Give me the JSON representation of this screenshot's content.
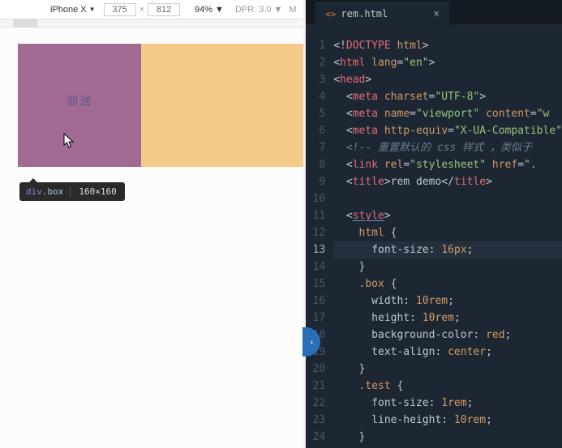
{
  "toolbar": {
    "device": "iPhone X",
    "width": "375",
    "height": "812",
    "dim_sep": "×",
    "zoom": "94%",
    "dpr_label": "DPR:",
    "dpr_value": "3.0",
    "m_label": "M"
  },
  "preview": {
    "box_text": "测试"
  },
  "inspect": {
    "element": "div",
    "class": ".box",
    "dimensions": "160×160"
  },
  "tab": {
    "filename": "rem.html",
    "icon_glyph": "<>"
  },
  "code": {
    "lines": [
      {
        "n": "1",
        "html": "<span class='p'>&lt;!</span><span class='t'>DOCTYPE</span> <span class='a'>html</span><span class='p'>&gt;</span>"
      },
      {
        "n": "2",
        "html": "<span class='p'>&lt;</span><span class='t'>html</span> <span class='a'>lang</span><span class='p'>=</span><span class='s'>\"en\"</span><span class='p'>&gt;</span>"
      },
      {
        "n": "3",
        "html": "<span class='p'>&lt;</span><span class='t'>head</span><span class='p'>&gt;</span>"
      },
      {
        "n": "4",
        "html": "  <span class='p'>&lt;</span><span class='t'>meta</span> <span class='a'>charset</span><span class='p'>=</span><span class='s'>\"UTF-8\"</span><span class='p'>&gt;</span>"
      },
      {
        "n": "5",
        "html": "  <span class='p'>&lt;</span><span class='t'>meta</span> <span class='a'>name</span><span class='p'>=</span><span class='s'>\"viewport\"</span> <span class='a'>content</span><span class='p'>=</span><span class='s'>\"w</span>"
      },
      {
        "n": "6",
        "html": "  <span class='p'>&lt;</span><span class='t'>meta</span> <span class='a'>http-equiv</span><span class='p'>=</span><span class='s'>\"X-UA-Compatible\"</span>"
      },
      {
        "n": "7",
        "html": "  <span class='cm'>&lt;!-- 重置默认的 css 样式 ，类似于</span>"
      },
      {
        "n": "8",
        "html": "  <span class='p'>&lt;</span><span class='t'>link</span> <span class='a'>rel</span><span class='p'>=</span><span class='s'>\"stylesheet\"</span> <span class='a'>href</span><span class='p'>=</span><span class='s'>\".</span>"
      },
      {
        "n": "9",
        "html": "  <span class='p'>&lt;</span><span class='t'>title</span><span class='p'>&gt;</span>rem demo<span class='p'>&lt;/</span><span class='t'>title</span><span class='p'>&gt;</span>"
      },
      {
        "n": "10",
        "html": ""
      },
      {
        "n": "11",
        "html": "  <span class='p'>&lt;</span><span class='t styleu'>style</span><span class='p'>&gt;</span>"
      },
      {
        "n": "12",
        "html": "    <span class='sel'>html</span> <span class='p'>{</span>"
      },
      {
        "n": "13",
        "hl": true,
        "html": "      <span class='cprop'>font-size:</span> <span class='num'>16px</span><span class='p'>;</span>"
      },
      {
        "n": "14",
        "html": "    <span class='p'>}</span>"
      },
      {
        "n": "15",
        "html": "    <span class='sel'>.box</span> <span class='p'>{</span>"
      },
      {
        "n": "16",
        "html": "      <span class='cprop'>width:</span> <span class='num'>10rem</span><span class='p'>;</span>"
      },
      {
        "n": "17",
        "html": "      <span class='cprop'>height:</span> <span class='num'>10rem</span><span class='p'>;</span>"
      },
      {
        "n": "18",
        "html": "      <span class='cprop'>background-color:</span> <span class='num'>red</span><span class='p'>;</span>"
      },
      {
        "n": "19",
        "html": "      <span class='cprop'>text-align:</span> <span class='num'>center</span><span class='p'>;</span>"
      },
      {
        "n": "20",
        "html": "    <span class='p'>}</span>"
      },
      {
        "n": "21",
        "html": "    <span class='sel'>.test</span> <span class='p'>{</span>"
      },
      {
        "n": "22",
        "html": "      <span class='cprop'>font-size:</span> <span class='num'>1rem</span><span class='p'>;</span>"
      },
      {
        "n": "23",
        "html": "      <span class='cprop'>line-height:</span> <span class='num'>10rem</span><span class='p'>;</span>"
      },
      {
        "n": "24",
        "html": "    <span class='p'>}</span>"
      }
    ]
  },
  "side_toggle_glyph": "›"
}
